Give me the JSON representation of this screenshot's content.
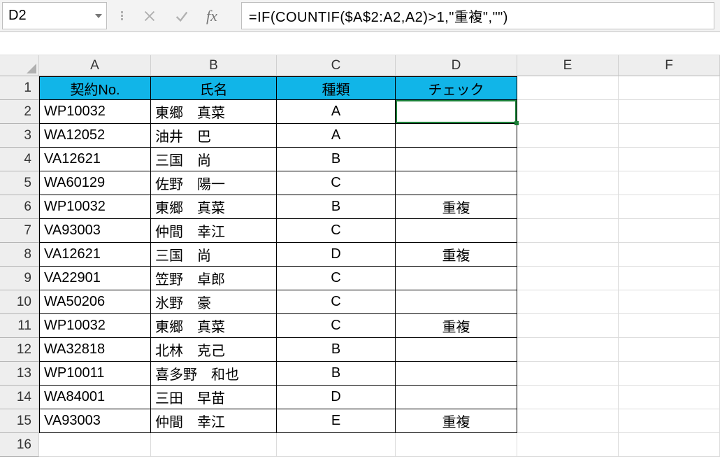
{
  "name_box": "D2",
  "formula": "=IF(COUNTIF($A$2:A2,A2)>1,\"重複\",\"\")",
  "fx_label": "fx",
  "columns": [
    "A",
    "B",
    "C",
    "D",
    "E",
    "F"
  ],
  "row_numbers": [
    "1",
    "2",
    "3",
    "4",
    "5",
    "6",
    "7",
    "8",
    "9",
    "10",
    "11",
    "12",
    "13",
    "14",
    "15",
    "16"
  ],
  "header_row": {
    "A": "契約No.",
    "B": "氏名",
    "C": "種類",
    "D": "チェック"
  },
  "rows": [
    {
      "A": "WP10032",
      "B": "東郷　真菜",
      "C": "A",
      "D": ""
    },
    {
      "A": "WA12052",
      "B": "油井　巴",
      "C": "A",
      "D": ""
    },
    {
      "A": "VA12621",
      "B": "三国　尚",
      "C": "B",
      "D": ""
    },
    {
      "A": "WA60129",
      "B": "佐野　陽一",
      "C": "C",
      "D": ""
    },
    {
      "A": "WP10032",
      "B": "東郷　真菜",
      "C": "B",
      "D": "重複"
    },
    {
      "A": "VA93003",
      "B": "仲間　幸江",
      "C": "C",
      "D": ""
    },
    {
      "A": "VA12621",
      "B": "三国　尚",
      "C": "D",
      "D": "重複"
    },
    {
      "A": "VA22901",
      "B": "笠野　卓郎",
      "C": "C",
      "D": ""
    },
    {
      "A": "WA50206",
      "B": "氷野　豪",
      "C": "C",
      "D": ""
    },
    {
      "A": "WP10032",
      "B": "東郷　真菜",
      "C": "C",
      "D": "重複"
    },
    {
      "A": "WA32818",
      "B": "北林　克己",
      "C": "B",
      "D": ""
    },
    {
      "A": "WP10011",
      "B": "喜多野　和也",
      "C": "B",
      "D": ""
    },
    {
      "A": "WA84001",
      "B": "三田　早苗",
      "C": "D",
      "D": ""
    },
    {
      "A": "VA93003",
      "B": "仲間　幸江",
      "C": "E",
      "D": "重複"
    }
  ]
}
